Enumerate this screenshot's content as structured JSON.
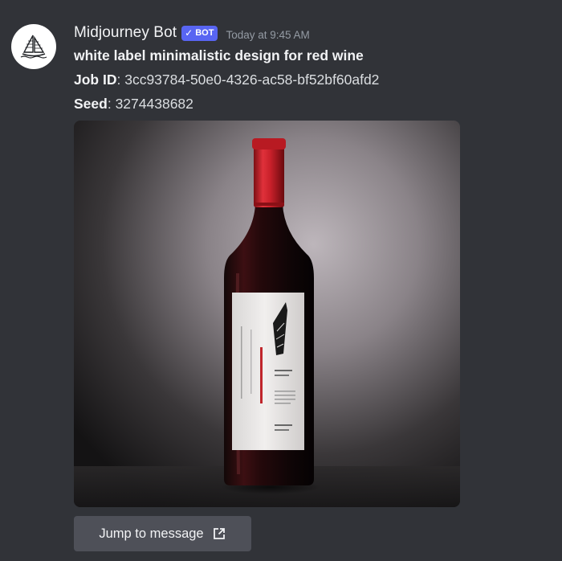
{
  "message": {
    "author": {
      "name": "Midjourney Bot",
      "tag_label": "BOT",
      "tag_check": "✓",
      "avatar_icon": "sailboat-icon"
    },
    "timestamp": "Today at 9:45 AM",
    "prompt": "white label minimalistic design for red wine",
    "job_id_label": "Job ID",
    "job_id_value": "3cc93784-50e0-4326-ac58-bf52bf60afd2",
    "seed_label": "Seed",
    "seed_value": "3274438682",
    "image": {
      "subject": "wine-bottle-image"
    },
    "jump_button": {
      "label": "Jump to message",
      "icon": "external-link-icon"
    }
  },
  "colors": {
    "background": "#313338",
    "bot_tag": "#5865f2",
    "button": "#4e5058",
    "timestamp": "#949ba4",
    "capsule_red": "#c8202a"
  }
}
